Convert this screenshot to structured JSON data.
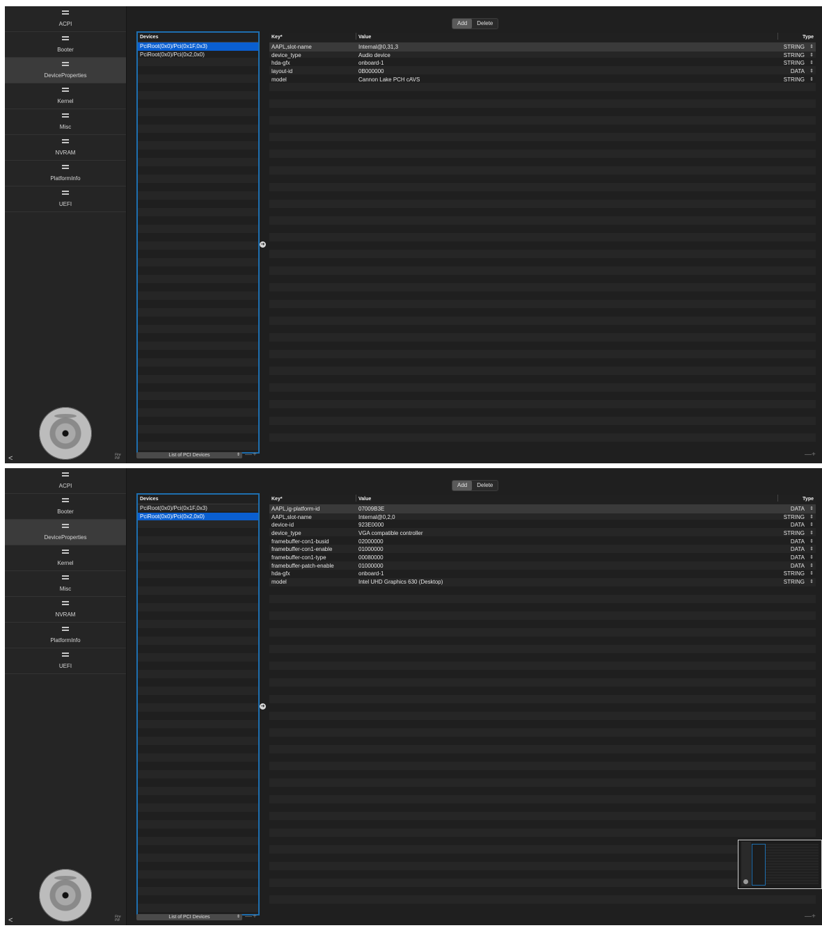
{
  "sidebar": {
    "items": [
      {
        "label": "ACPI",
        "icon": "list-icon"
      },
      {
        "label": "Booter",
        "icon": "list-icon"
      },
      {
        "label": "DeviceProperties",
        "icon": "list-icon"
      },
      {
        "label": "Kernel",
        "icon": "list-icon"
      },
      {
        "label": "Misc",
        "icon": "list-icon"
      },
      {
        "label": "NVRAM",
        "icon": "list-icon"
      },
      {
        "label": "PlatformInfo",
        "icon": "list-icon"
      },
      {
        "label": "UEFI",
        "icon": "list-icon"
      }
    ],
    "selected": "DeviceProperties",
    "share_icon": "share-icon",
    "logo_text": "Fire Pill"
  },
  "toolbar": {
    "add_label": "Add",
    "delete_label": "Delete"
  },
  "device_list": {
    "header": "Devices",
    "items": [
      "PciRoot(0x0)/Pci(0x1F,0x3)",
      "PciRoot(0x0)/Pci(0x2,0x0)"
    ],
    "footer_select": "List of PCI Devices",
    "minus": "—",
    "plus": "+"
  },
  "props_header": {
    "key": "Key*",
    "value": "Value",
    "type": "Type"
  },
  "panels": [
    {
      "selected_device": 0,
      "rows": [
        {
          "key": "AAPL,slot-name",
          "value": "Internal@0,31,3",
          "type": "STRING"
        },
        {
          "key": "device_type",
          "value": "Audio device",
          "type": "STRING"
        },
        {
          "key": "hda-gfx",
          "value": "onboard-1",
          "type": "STRING"
        },
        {
          "key": "layout-id",
          "value": "0B000000",
          "type": "DATA"
        },
        {
          "key": "model",
          "value": "Cannon Lake PCH cAVS",
          "type": "STRING"
        }
      ]
    },
    {
      "selected_device": 1,
      "rows": [
        {
          "key": "AAPL,ig-platform-id",
          "value": "07009B3E",
          "type": "DATA"
        },
        {
          "key": "AAPL,slot-name",
          "value": "Internal@0,2,0",
          "type": "STRING"
        },
        {
          "key": "device-id",
          "value": "923E0000",
          "type": "DATA"
        },
        {
          "key": "device_type",
          "value": "VGA compatible controller",
          "type": "STRING"
        },
        {
          "key": "framebuffer-con1-busid",
          "value": "02000000",
          "type": "DATA"
        },
        {
          "key": "framebuffer-con1-enable",
          "value": "01000000",
          "type": "DATA"
        },
        {
          "key": "framebuffer-con1-type",
          "value": "00080000",
          "type": "DATA"
        },
        {
          "key": "framebuffer-patch-enable",
          "value": "01000000",
          "type": "DATA"
        },
        {
          "key": "hda-gfx",
          "value": "onboard-1",
          "type": "STRING"
        },
        {
          "key": "model",
          "value": "Intel UHD Graphics 630 (Desktop)",
          "type": "STRING"
        }
      ]
    }
  ],
  "accent_color": "#0a5fd1",
  "focus_ring_color": "#1e6fb0"
}
